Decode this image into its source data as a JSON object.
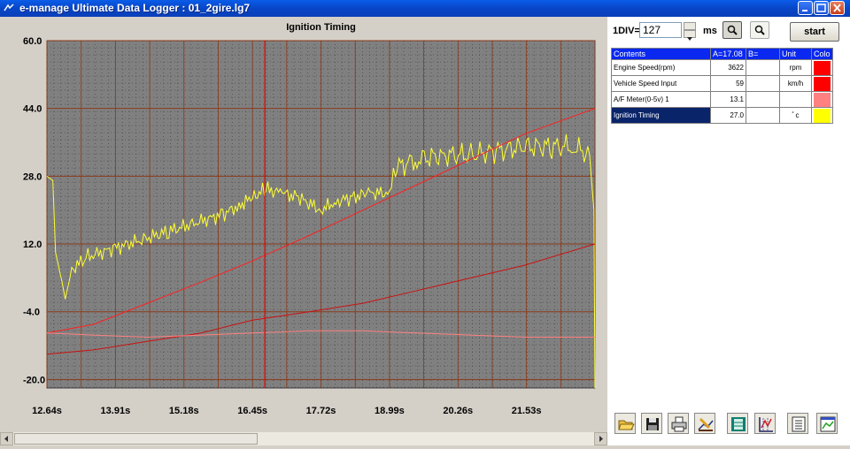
{
  "window": {
    "title": "e-manage Ultimate Data Logger : 01_2gire.lg7"
  },
  "chart_data": {
    "type": "line",
    "title": "Ignition Timing",
    "xlabel": "",
    "ylabel": "",
    "xlim": [
      12.64,
      22.8
    ],
    "ylim": [
      -22.0,
      60.0
    ],
    "y_ticks": [
      "60.0",
      "44.0",
      "28.0",
      "12.0",
      "-4.0",
      "-20.0"
    ],
    "x_ticks": [
      "12.64s",
      "13.91s",
      "15.18s",
      "16.45s",
      "17.72s",
      "18.99s",
      "20.26s",
      "21.53s"
    ],
    "cursor_x": 16.68,
    "grid": true,
    "series": [
      {
        "color": "#ffff33",
        "x": [
          12.64,
          12.75,
          12.8,
          12.92,
          12.98,
          13.1,
          13.4,
          13.9,
          14.4,
          14.9,
          15.4,
          15.9,
          16.2,
          16.45,
          16.7,
          17.0,
          17.3,
          17.72,
          18.0,
          18.3,
          18.6,
          18.99,
          19.1,
          19.5,
          20.0,
          20.5,
          21.0,
          21.5,
          22.0,
          22.4,
          22.7,
          22.78,
          22.8
        ],
        "y": [
          28,
          27,
          10,
          3,
          -1,
          6,
          9,
          11,
          13,
          15,
          17,
          19,
          21,
          23,
          25,
          24,
          23,
          20,
          22,
          23,
          24,
          24,
          30,
          32,
          33,
          33,
          34,
          35,
          35,
          35,
          33,
          20,
          -22
        ]
      },
      {
        "color": "#ff2020",
        "x": [
          12.64,
          13.5,
          14.5,
          15.5,
          16.45,
          17.5,
          18.5,
          19.5,
          20.5,
          21.5,
          22.8
        ],
        "y": [
          -9,
          -7,
          -2,
          3,
          8,
          14,
          20,
          26,
          32,
          38,
          44
        ]
      },
      {
        "color": "#cc1010",
        "x": [
          12.64,
          13.5,
          14.5,
          15.5,
          16.45,
          17.5,
          18.5,
          19.5,
          20.5,
          21.5,
          22.8
        ],
        "y": [
          -14,
          -13,
          -11,
          -9,
          -6,
          -4,
          -2,
          1,
          4,
          7,
          12
        ]
      },
      {
        "color": "#ff8080",
        "x": [
          12.64,
          13.5,
          14.5,
          15.5,
          16.45,
          17.5,
          18.5,
          19.5,
          20.5,
          21.5,
          22.8
        ],
        "y": [
          -9,
          -9.5,
          -10,
          -9.5,
          -9,
          -8.5,
          -8.5,
          -9,
          -9.5,
          -10,
          -10
        ]
      }
    ]
  },
  "controls": {
    "div_label": "1DIV=",
    "div_value": "127",
    "unit": "ms",
    "start_label": "start"
  },
  "table": {
    "headers": {
      "contents": "Contents",
      "a": "A=17.08",
      "b": "B=",
      "unit": "Unit",
      "color": "Colo"
    },
    "rows": [
      {
        "contents": "Engine Speed(rpm)",
        "a": "3622",
        "b": "",
        "unit": "rpm",
        "color": "#ff0000"
      },
      {
        "contents": "Vehicle Speed Input",
        "a": "59",
        "b": "",
        "unit": "km/h",
        "color": "#ff0000"
      },
      {
        "contents": "A/F Meter(0-5v) 1",
        "a": "13.1",
        "b": "",
        "unit": "",
        "color": "#ff8080"
      },
      {
        "contents": "Ignition Timing",
        "a": "27.0",
        "b": "",
        "unit": "ﾟc",
        "color": "#ffff00"
      }
    ]
  },
  "toolbar": {
    "icons": [
      "open-folder-icon",
      "save-disk-icon",
      "print-icon",
      "edit-data-icon",
      "table-view-icon",
      "chart-settings-icon",
      "list-view-icon",
      "graph-window-icon"
    ]
  }
}
